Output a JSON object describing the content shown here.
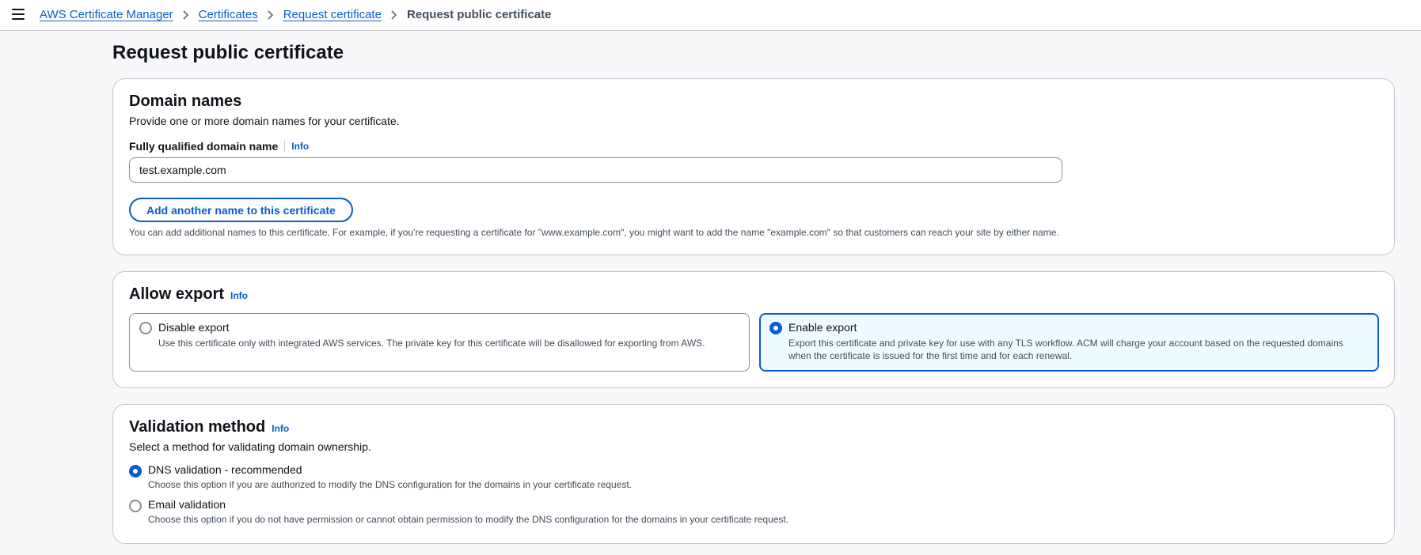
{
  "breadcrumbs": {
    "items": [
      "AWS Certificate Manager",
      "Certificates",
      "Request certificate"
    ],
    "current": "Request public certificate"
  },
  "page": {
    "title": "Request public certificate"
  },
  "domain_names": {
    "heading": "Domain names",
    "description": "Provide one or more domain names for your certificate.",
    "field_label": "Fully qualified domain name",
    "info": "Info",
    "input_value": "test.example.com",
    "add_button": "Add another name to this certificate",
    "hint": "You can add additional names to this certificate. For example, if you're requesting a certificate for \"www.example.com\", you might want to add the name \"example.com\" so that customers can reach your site by either name."
  },
  "allow_export": {
    "heading": "Allow export",
    "info": "Info",
    "options": [
      {
        "label": "Disable export",
        "description": "Use this certificate only with integrated AWS services. The private key for this certificate will be disallowed for exporting from AWS.",
        "selected": false
      },
      {
        "label": "Enable export",
        "description": "Export this certificate and private key for use with any TLS workflow. ACM will charge your account based on the requested domains when the certificate is issued for the first time and for each renewal.",
        "selected": true
      }
    ]
  },
  "validation_method": {
    "heading": "Validation method",
    "info": "Info",
    "description": "Select a method for validating domain ownership.",
    "options": [
      {
        "label": "DNS validation - recommended",
        "description": "Choose this option if you are authorized to modify the DNS configuration for the domains in your certificate request.",
        "selected": true
      },
      {
        "label": "Email validation",
        "description": "Choose this option if you do not have permission or cannot obtain permission to modify the DNS configuration for the domains in your certificate request.",
        "selected": false
      }
    ]
  },
  "colors": {
    "link": "#0a5ccf",
    "selected_tile_bg": "#f0fbff",
    "page_bg": "#f8f8fa"
  }
}
